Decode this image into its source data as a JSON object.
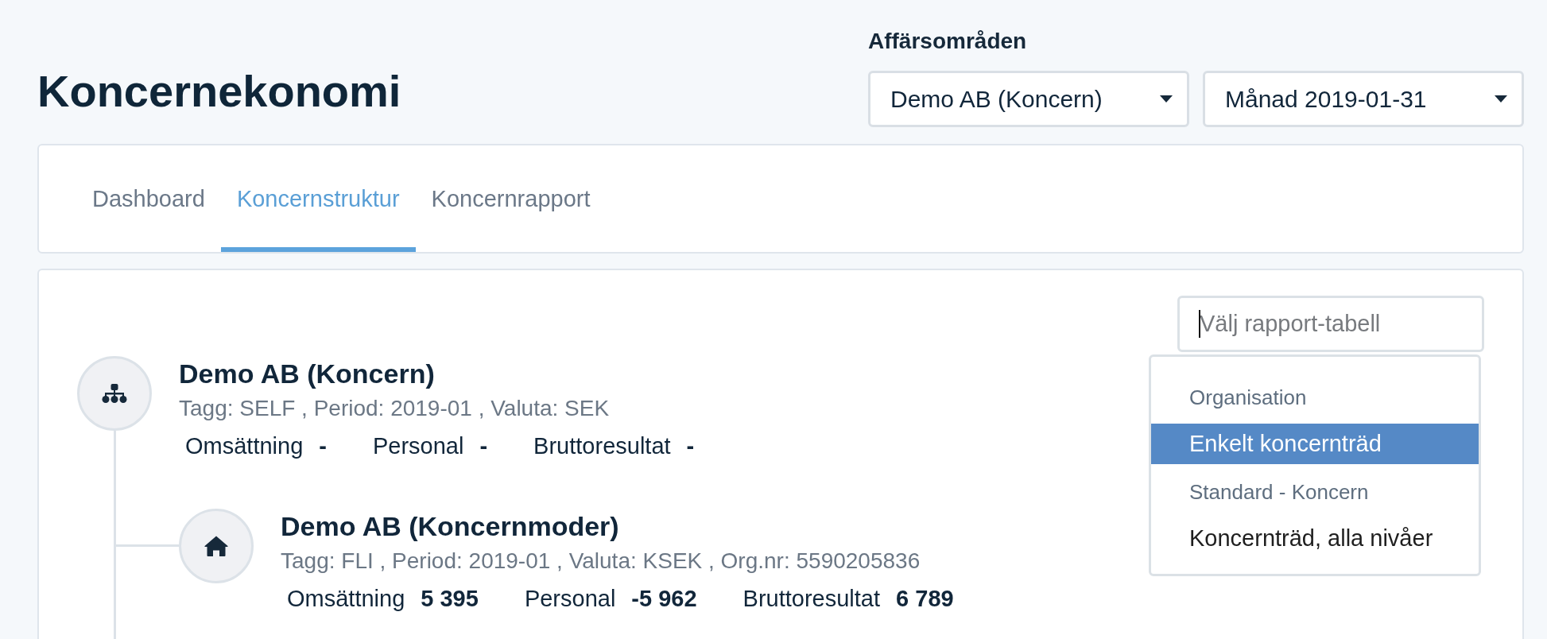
{
  "page": {
    "title": "Koncernekonomi"
  },
  "filters": {
    "label": "Affärsområden",
    "selects": [
      {
        "value": "Demo AB (Koncern)"
      },
      {
        "value": "Månad 2019-01-31"
      }
    ]
  },
  "tabs": [
    {
      "label": "Dashboard",
      "selected": false
    },
    {
      "label": "Koncernstruktur",
      "selected": true
    },
    {
      "label": "Koncernrapport",
      "selected": false
    }
  ],
  "tree": [
    {
      "kind": "group",
      "name": "Demo AB (Koncern)",
      "meta": "Tagg: SELF , Period: 2019-01 , Valuta: SEK",
      "metrics": [
        {
          "label": "Omsättning",
          "value": "-"
        },
        {
          "label": "Personal",
          "value": "-"
        },
        {
          "label": "Bruttoresultat",
          "value": "-"
        }
      ],
      "children": [
        {
          "kind": "company",
          "name": "Demo AB (Koncernmoder)",
          "meta": "Tagg: FLI , Period: 2019-01 , Valuta: KSEK , Org.nr: 5590205836",
          "metrics": [
            {
              "label": "Omsättning",
              "value": "5 395"
            },
            {
              "label": "Personal",
              "value": "-5 962"
            },
            {
              "label": "Bruttoresultat",
              "value": "6 789"
            }
          ]
        }
      ]
    }
  ],
  "report_picker": {
    "placeholder": "Välj rapport-tabell",
    "focused": true,
    "menu": [
      {
        "label": "Organisation",
        "options": [
          {
            "label": "Enkelt koncernträd",
            "selected": true
          }
        ]
      },
      {
        "label": "Standard - Koncern",
        "options": [
          {
            "label": "Koncernträd, alla nivåer",
            "selected": false
          }
        ]
      }
    ]
  }
}
